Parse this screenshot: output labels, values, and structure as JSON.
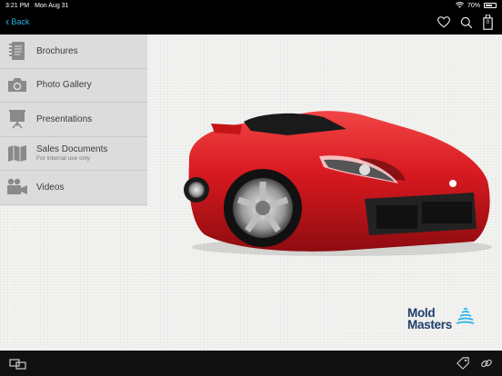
{
  "status": {
    "time": "3:21 PM",
    "date": "Mon Aug 31",
    "battery": "70%",
    "battery_level": 0.7
  },
  "nav": {
    "back_label": "Back",
    "icons": [
      "heart-icon",
      "search-icon",
      "cart-icon"
    ],
    "cart_count": "0"
  },
  "menu": {
    "items": [
      {
        "label": "Brochures",
        "icon": "brochure-icon"
      },
      {
        "label": "Photo Gallery",
        "icon": "camera-icon"
      },
      {
        "label": "Presentations",
        "icon": "presentation-icon"
      },
      {
        "label": "Sales Documents",
        "sublabel": "For internal use only",
        "icon": "map-icon"
      },
      {
        "label": "Videos",
        "icon": "video-camera-icon"
      }
    ]
  },
  "brand": {
    "line1": "Mold",
    "line2": "Masters",
    "color": "#1f3d6b"
  },
  "colors": {
    "accent": "#2ab3e6",
    "menu_bg": "#dcdcdc",
    "car_red": "#d71920"
  },
  "tabbar": {
    "icons": [
      "screen-share-icon",
      "tag-icon",
      "link-icon"
    ]
  }
}
